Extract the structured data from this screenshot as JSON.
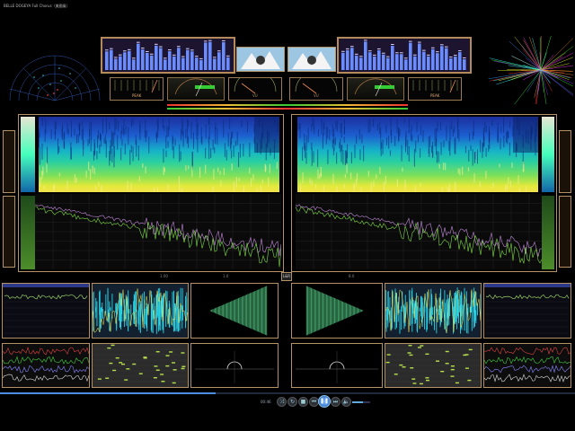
{
  "window": {
    "title": "BELLE DOGEYA Full Chorus（美國風）"
  },
  "meters": {
    "left_peak_label": "PEAK",
    "left_vu_label": "VU",
    "right_vu_label": "VU",
    "right_peak_label": "PEAK"
  },
  "labels": {
    "center_button": "L&R",
    "freq_left_1": "1.00",
    "freq_left_2": "1.0",
    "freq_right_1": "8.0"
  },
  "player": {
    "time": "00:46",
    "volume_level": 0.6
  },
  "icons": [
    "play-icon",
    "prev-icon",
    "next-icon",
    "stop-icon",
    "shuffle-icon",
    "repeat-icon",
    "volume-icon"
  ],
  "colors": {
    "frame": "#b49266",
    "accent": "#4a90e2"
  }
}
